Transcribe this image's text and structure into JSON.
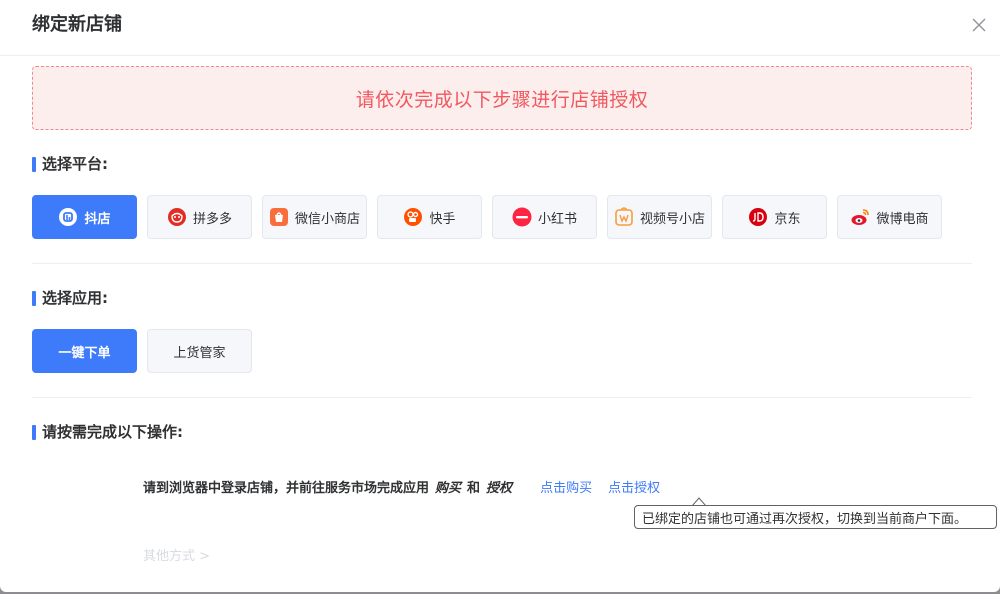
{
  "dialog": {
    "title": "绑定新店铺",
    "close_icon": "close-icon"
  },
  "alert": {
    "text": "请依次完成以下步骤进行店铺授权",
    "color": "#f0585f"
  },
  "platform_section": {
    "title": "选择平台:",
    "selected": "抖店",
    "items": [
      {
        "label": "抖店",
        "icon": "douyin-shop-icon",
        "active": true
      },
      {
        "label": "拼多多",
        "icon": "pinduoduo-icon",
        "active": false
      },
      {
        "label": "微信小商店",
        "icon": "wechat-shop-icon",
        "active": false
      },
      {
        "label": "快手",
        "icon": "kuaishou-icon",
        "active": false
      },
      {
        "label": "小红书",
        "icon": "xiaohongshu-icon",
        "active": false
      },
      {
        "label": "视频号小店",
        "icon": "channels-shop-icon",
        "active": false
      },
      {
        "label": "京东",
        "icon": "jd-icon",
        "active": false
      },
      {
        "label": "微博电商",
        "icon": "weibo-icon",
        "active": false
      }
    ]
  },
  "app_section": {
    "title": "选择应用:",
    "items": [
      {
        "label": "一键下单",
        "active": true
      },
      {
        "label": "上货管家",
        "active": false
      }
    ]
  },
  "ops_section": {
    "title": "请按需完成以下操作:",
    "instruction_prefix": "请到浏览器中登录店铺，并前往服务市场完成应用",
    "buy_word": "购买",
    "and_word": "和",
    "auth_word": "授权",
    "buy_link": "点击购买",
    "auth_link": "点击授权",
    "tooltip": "已绑定的店铺也可通过再次授权，切换到当前商户下面。",
    "other_way": "其他方式 >"
  },
  "colors": {
    "primary": "#3e7bfa",
    "alert_bg": "#fdeeee",
    "alert_border": "#f08a8f"
  }
}
